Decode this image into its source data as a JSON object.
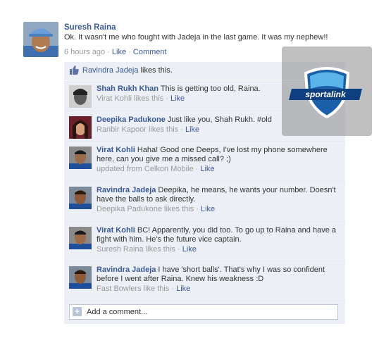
{
  "post": {
    "author": "Suresh Raina",
    "text": "Ok. It wasn't me who fought with Jadeja in the last game. It was my nephew!!",
    "time": "6 hours ago",
    "like_label": "Like",
    "comment_label": "Comment",
    "separator": "·"
  },
  "likes": {
    "name": "Ravindra Jadeja",
    "suffix": " likes this."
  },
  "comments": [
    {
      "name": "Shah Rukh Khan",
      "text": " This is getting too old, Raina.",
      "meta": "Virat Kohli likes this",
      "action": "Like"
    },
    {
      "name": "Deepika Padukone",
      "text": " Just like you, Shah Rukh. #old",
      "meta": "Ranbir Kapoor likes this",
      "action": "Like"
    },
    {
      "name": "Virat Kohli",
      "text": " Haha! Good one Deeps, I've lost my phone somewhere here, can you give me a missed call? ;)",
      "meta": "updated from Celkon Mobile",
      "action": "Like"
    },
    {
      "name": "Ravindra Jadeja",
      "text": " Deepika, he means, he wants your number. Doesn't have the balls to ask directly.",
      "meta": "Deepika Padukone likes this",
      "action": "Like"
    },
    {
      "name": "Virat Kohli",
      "text": " BC! Apparently, you did too. To go up to Raina and have a fight with him. He's the future vice captain.",
      "meta": "Suresh Raina likes this",
      "action": "Like"
    },
    {
      "name": "Ravindra Jadeja",
      "text": " I have 'short balls'. That's why I was so confident before I went after Raina. Knew his weakness :D",
      "meta": "Fast Bowlers like this",
      "action": "Like"
    }
  ],
  "add_comment": {
    "placeholder": "Add a comment..."
  },
  "watermark": {
    "brand": "sportalink"
  },
  "colors": {
    "link": "#3b5998",
    "comment_bg": "#eceff5",
    "meta": "#999999"
  }
}
